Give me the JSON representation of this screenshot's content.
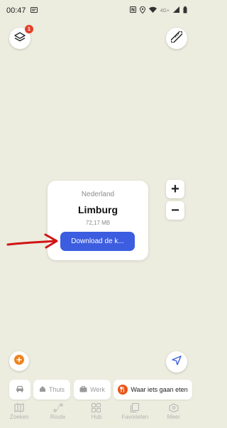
{
  "status_bar": {
    "time": "00:47",
    "signal_text": "4G+"
  },
  "map_controls": {
    "layers_badge_count": "1",
    "zoom_in": "+",
    "zoom_out": "−"
  },
  "region_card": {
    "country": "Nederland",
    "region": "Limburg",
    "size": "72,17 MB",
    "download_button_label": "Download de k..."
  },
  "quick_chips": [
    {
      "label": ""
    },
    {
      "label": "Thuis"
    },
    {
      "label": "Werk"
    },
    {
      "label": "Waar iets gaan eten"
    }
  ],
  "bottom_nav": [
    {
      "label": "Zoeken",
      "icon": "map-book-icon"
    },
    {
      "label": "Route",
      "icon": "route-icon"
    },
    {
      "label": "Hub",
      "icon": "grid-icon"
    },
    {
      "label": "Favorieten",
      "icon": "bookmark-icon"
    },
    {
      "label": "Meer",
      "icon": "more-icon"
    }
  ],
  "colors": {
    "map_background": "#ececdf",
    "accent_blue": "#3c5de0",
    "badge_red": "#e2412c",
    "orange": "#e8541a",
    "annotation_red": "#d11414"
  }
}
